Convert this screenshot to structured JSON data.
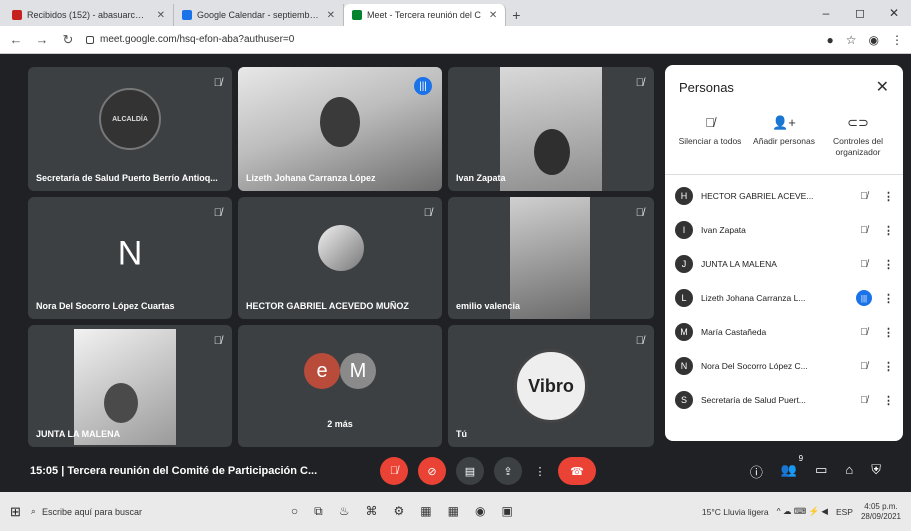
{
  "browser": {
    "tabs": [
      {
        "label": "Recibidos (152) - abasuarcebes...",
        "icon_color": "#c5221f",
        "active": false
      },
      {
        "label": "Google Calendar - septiembre d...",
        "icon_color": "#1a73e8",
        "active": false
      },
      {
        "label": "Meet - Tercera reunión del C",
        "icon_color": "#00832d",
        "active": true
      }
    ],
    "new_tab": "+",
    "url": "meet.google.com/hsq-efon-aba?authuser=0"
  },
  "tiles": [
    {
      "name": "Secretaría de Salud Puerto Berrío Antioq..."
    },
    {
      "name": "Lizeth Johana Carranza López"
    },
    {
      "name": "Ivan Zapata"
    },
    {
      "name": "Nora Del Socorro López Cuartas",
      "letter": "N"
    },
    {
      "name": "HECTOR GABRIEL ACEVEDO MUÑOZ"
    },
    {
      "name": "emilio valencia"
    },
    {
      "name": "JUNTA LA MALENA"
    },
    {
      "name": "2 más",
      "avatars": [
        "e",
        "M"
      ]
    },
    {
      "name": "Tú",
      "logo_text": "Vibro"
    }
  ],
  "panel": {
    "title": "Personas",
    "actions": [
      {
        "label": "Silenciar a todos",
        "icon": "mic-off-icon"
      },
      {
        "label": "Añadir personas",
        "icon": "add-person-icon"
      },
      {
        "label": "Controles del organizador",
        "icon": "toggle-icon"
      }
    ],
    "people": [
      {
        "name": "HECTOR GABRIEL ACEVE...",
        "avatar": "H"
      },
      {
        "name": "Ivan Zapata",
        "avatar": "I"
      },
      {
        "name": "JUNTA LA MALENA",
        "avatar": "J"
      },
      {
        "name": "Lizeth Johana Carranza L...",
        "avatar": "L",
        "speaking": true
      },
      {
        "name": "María Castañeda",
        "avatar": "M"
      },
      {
        "name": "Nora Del Socorro López C...",
        "avatar": "N"
      },
      {
        "name": "Secretaría de Salud Puert...",
        "avatar": "S"
      }
    ]
  },
  "meeting": {
    "time": "15:05",
    "separator": "|",
    "title": "Tercera reunión del Comité de Participación C...",
    "participants_count": "9"
  },
  "taskbar": {
    "search_placeholder": "Escribe aquí para buscar",
    "weather": "15°C Lluvia ligera",
    "time": "4:05 p.m.",
    "date": "28/09/2021",
    "lang": "ESP"
  }
}
